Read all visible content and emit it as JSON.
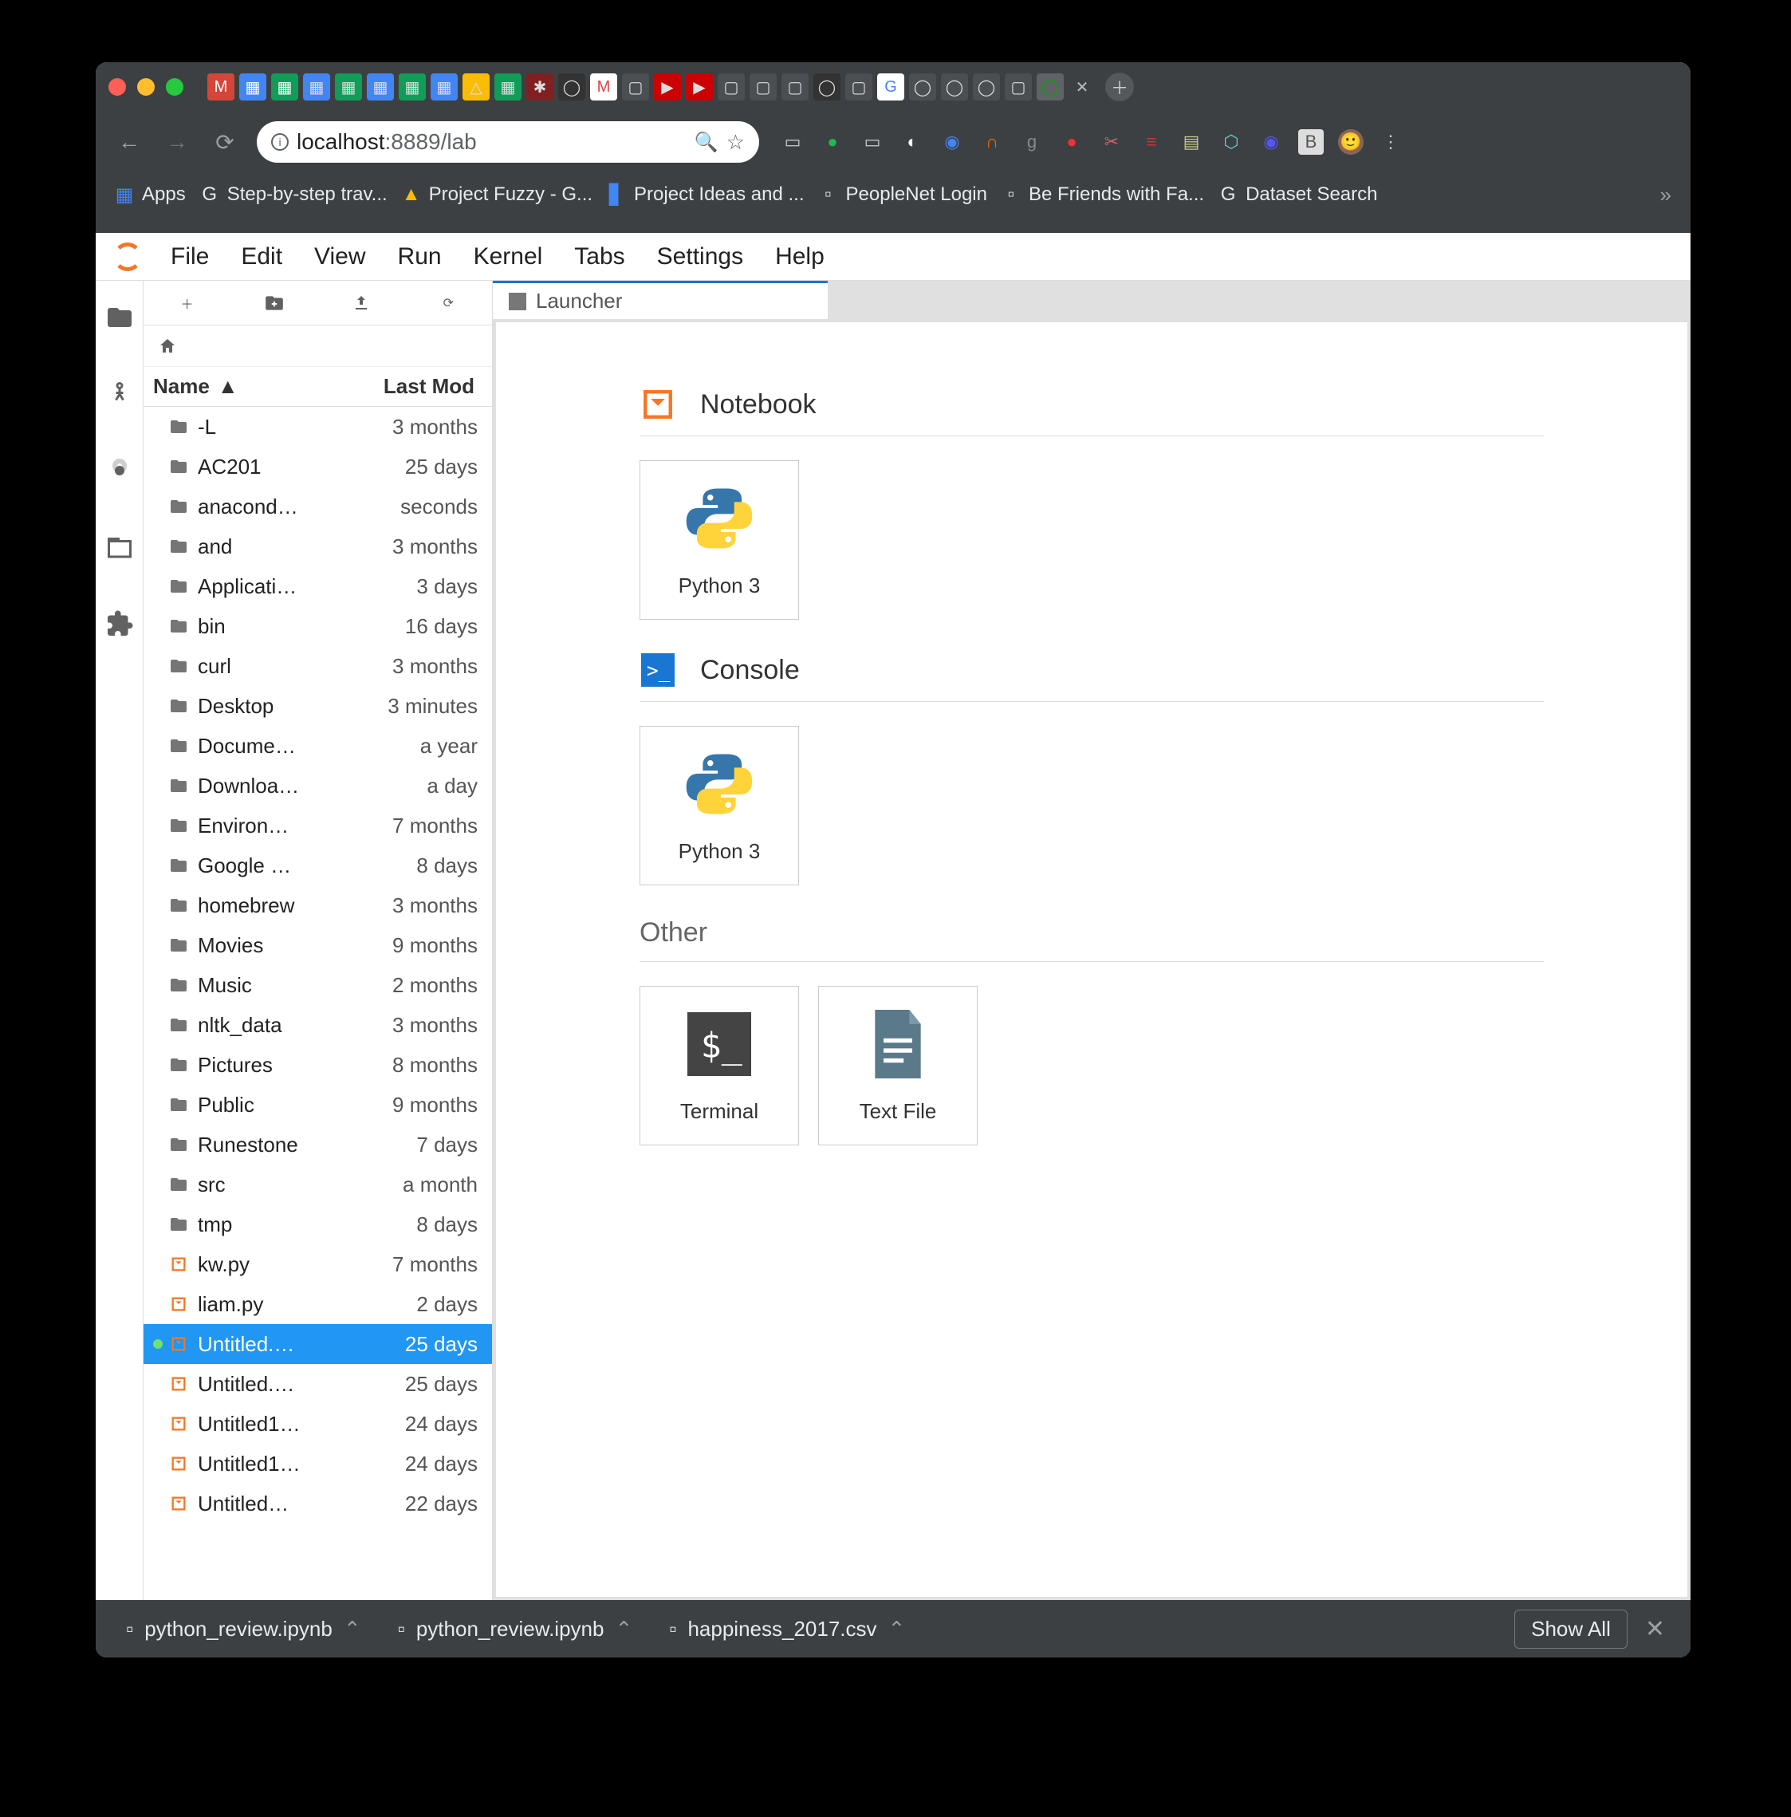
{
  "address_bar": {
    "host": "localhost",
    "rest": ":8889/lab"
  },
  "bookmarks": {
    "apps": "Apps",
    "items": [
      {
        "label": "Step-by-step trav..."
      },
      {
        "label": "Project Fuzzy - G..."
      },
      {
        "label": "Project Ideas and ..."
      },
      {
        "label": "PeopleNet Login"
      },
      {
        "label": "Be Friends with Fa..."
      },
      {
        "label": "Dataset Search"
      }
    ]
  },
  "menu": [
    "File",
    "Edit",
    "View",
    "Run",
    "Kernel",
    "Tabs",
    "Settings",
    "Help"
  ],
  "tab": {
    "title": "Launcher"
  },
  "filebrowser": {
    "columns": {
      "name": "Name",
      "modified": "Last Mod"
    },
    "items": [
      {
        "name": "-L",
        "modified": "3 months",
        "type": "folder"
      },
      {
        "name": "AC201",
        "modified": "25 days",
        "type": "folder"
      },
      {
        "name": "anacond…",
        "modified": "seconds",
        "type": "folder"
      },
      {
        "name": "and",
        "modified": "3 months",
        "type": "folder"
      },
      {
        "name": "Applicati…",
        "modified": "3 days",
        "type": "folder"
      },
      {
        "name": "bin",
        "modified": "16 days",
        "type": "folder"
      },
      {
        "name": "curl",
        "modified": "3 months",
        "type": "folder"
      },
      {
        "name": "Desktop",
        "modified": "3 minutes",
        "type": "folder"
      },
      {
        "name": "Docume…",
        "modified": "a year",
        "type": "folder"
      },
      {
        "name": "Downloa…",
        "modified": "a day",
        "type": "folder"
      },
      {
        "name": "Environ…",
        "modified": "7 months",
        "type": "folder"
      },
      {
        "name": "Google …",
        "modified": "8 days",
        "type": "folder"
      },
      {
        "name": "homebrew",
        "modified": "3 months",
        "type": "folder"
      },
      {
        "name": "Movies",
        "modified": "9 months",
        "type": "folder"
      },
      {
        "name": "Music",
        "modified": "2 months",
        "type": "folder"
      },
      {
        "name": "nltk_data",
        "modified": "3 months",
        "type": "folder"
      },
      {
        "name": "Pictures",
        "modified": "8 months",
        "type": "folder"
      },
      {
        "name": "Public",
        "modified": "9 months",
        "type": "folder"
      },
      {
        "name": "Runestone",
        "modified": "7 days",
        "type": "folder"
      },
      {
        "name": "src",
        "modified": "a month",
        "type": "folder"
      },
      {
        "name": "tmp",
        "modified": "8 days",
        "type": "folder"
      },
      {
        "name": "kw.py",
        "modified": "7 months",
        "type": "nb"
      },
      {
        "name": "liam.py",
        "modified": "2 days",
        "type": "nb"
      },
      {
        "name": "Untitled.…",
        "modified": "25 days",
        "type": "nb",
        "active": true
      },
      {
        "name": "Untitled.…",
        "modified": "25 days",
        "type": "nb"
      },
      {
        "name": "Untitled1…",
        "modified": "24 days",
        "type": "nb"
      },
      {
        "name": "Untitled1…",
        "modified": "24 days",
        "type": "nb"
      },
      {
        "name": "Untitled…",
        "modified": "22 days",
        "type": "nb"
      }
    ]
  },
  "launcher": {
    "sections": [
      {
        "title": "Notebook",
        "cards": [
          {
            "label": "Python 3",
            "icon": "python"
          }
        ],
        "icon": "notebook"
      },
      {
        "title": "Console",
        "cards": [
          {
            "label": "Python 3",
            "icon": "python"
          }
        ],
        "icon": "console"
      },
      {
        "title": "Other",
        "cards": [
          {
            "label": "Terminal",
            "icon": "terminal"
          },
          {
            "label": "Text File",
            "icon": "textfile"
          }
        ],
        "icon": "none"
      }
    ]
  },
  "footer": {
    "items": [
      {
        "label": "python_review.ipynb"
      },
      {
        "label": "python_review.ipynb"
      },
      {
        "label": "happiness_2017.csv"
      }
    ],
    "showall": "Show All"
  }
}
